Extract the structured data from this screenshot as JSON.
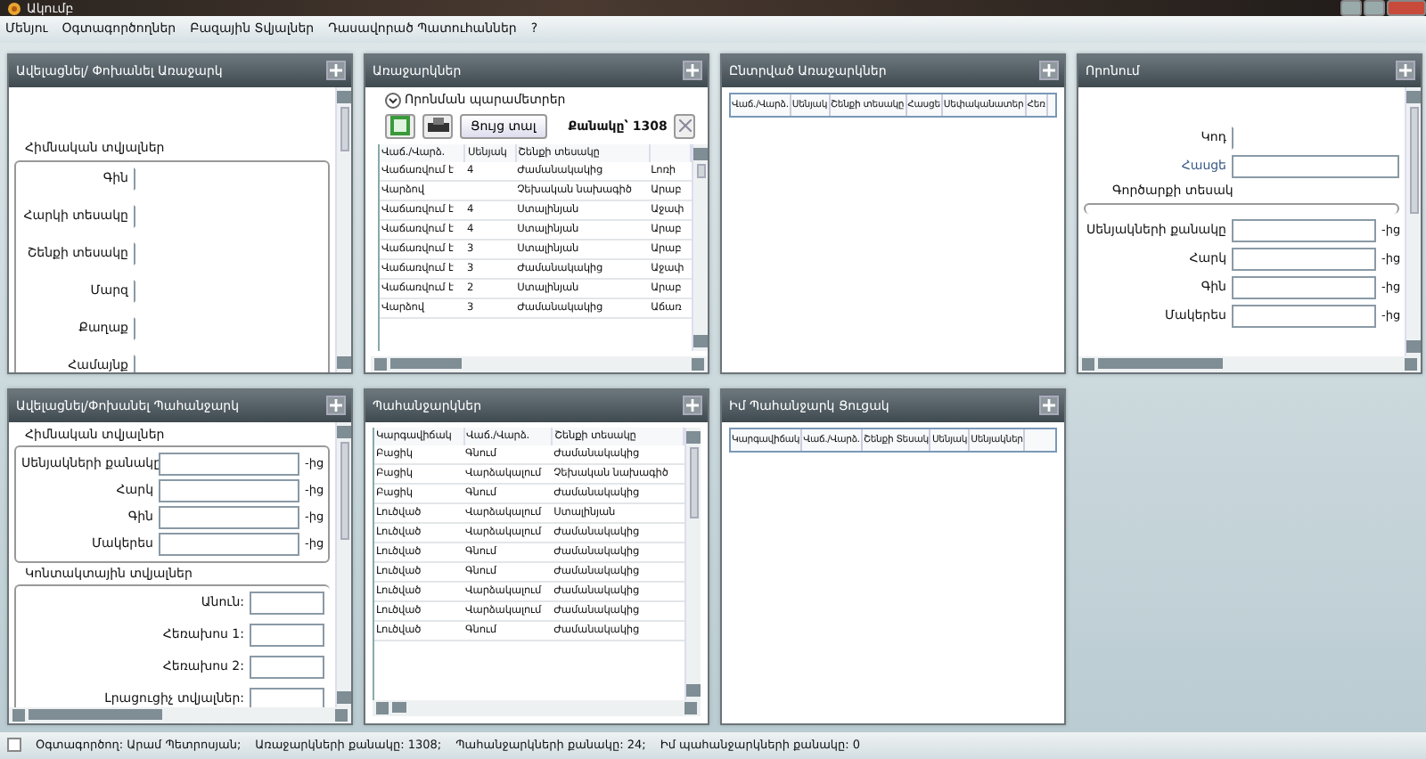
{
  "window": {
    "title": "Ակումբ"
  },
  "menu": [
    "Մենյու",
    "Օգտագործողներ",
    "Բազային Տվյալներ",
    "Դասավորած Պատուհաններ",
    "?"
  ],
  "offer_form": {
    "title": "Ավելացնել/ Փոխանել Առաջարկ",
    "group": {
      "title": "Հիմնական տվյալներ",
      "rows": [
        "Գին",
        "Հարկի տեսակը",
        "Շենքի տեսակը",
        "Մարզ",
        "Քաղաք",
        "Համայնք"
      ]
    }
  },
  "offers": {
    "title": "Առաջարկներ",
    "filter": {
      "label": "Որոնման պարամետրեր",
      "expanded": false
    },
    "show_button": "Ցույց տալ",
    "count": "Քանակը՝ 1308",
    "columns": [
      "Վաճ./Վարձ.",
      "Սենյակ",
      "Շենքի տեսակը",
      ""
    ],
    "rows": [
      [
        "Վաճառվում է",
        "4",
        "Ժամանակակից",
        "Լոռի"
      ],
      [
        "Վարձով",
        "",
        "Չեխական նախագիծ",
        "Արաբ"
      ],
      [
        "Վաճառվում է",
        "4",
        "Ստալինյան",
        "Աջափ"
      ],
      [
        "Վաճառվում է",
        "4",
        "Ստալինյան",
        "Արաբ"
      ],
      [
        "Վաճառվում է",
        "3",
        "Ստալինյան",
        "Արաբ"
      ],
      [
        "Վաճառվում է",
        "3",
        "Ժամանակակից",
        "Աջափ"
      ],
      [
        "Վաճառվում է",
        "2",
        "Ստալինյան",
        "Արաբ"
      ],
      [
        "Վարձով",
        "3",
        "Ժամանակակից",
        "Աճառ"
      ]
    ]
  },
  "selected_offers": {
    "title": "Ընտրված Առաջարկներ",
    "columns": [
      "Վաճ./Վարձ.",
      "Սենյակ",
      "Շենքի տեսակը",
      "Հասցե",
      "Սեփականատեր",
      "Հեռ"
    ]
  },
  "search_form": {
    "title": "Որոնում",
    "fields": [
      "Կոդ",
      "Հասցե"
    ],
    "group": "Գործարքի տեսակ",
    "rows": [
      {
        "label": "Սենյակների քանակը",
        "unit": "-ից"
      },
      {
        "label": "Հարկ",
        "unit": "-ից"
      },
      {
        "label": "Գին",
        "unit": "-ից"
      },
      {
        "label": "Մակերես",
        "unit": "-ից"
      }
    ]
  },
  "demand_form": {
    "title": "Ավելացնել/Փոխանել Պահանջարկ",
    "main": {
      "title": "Հիմնական տվյալներ",
      "rows": [
        {
          "label": "Սենյակների քանակը",
          "unit": "-ից"
        },
        {
          "label": "Հարկ",
          "unit": "-ից"
        },
        {
          "label": "Գին",
          "unit": "-ից"
        },
        {
          "label": "Մակերես",
          "unit": "-ից"
        }
      ]
    },
    "contact": {
      "title": "Կոնտակտային տվյալներ",
      "rows": [
        "Անուն:",
        "Հեռախոս 1:",
        "Հեռախոս 2:",
        "Լրացուցիչ տվյալներ:"
      ]
    }
  },
  "demands": {
    "title": "Պահանջարկներ",
    "columns": [
      "Կարգավիճակ",
      "Վաճ./Վարձ.",
      "Շենքի տեսակը"
    ],
    "rows": [
      [
        "Բացիկ",
        "Գնում",
        "Ժամանակակից"
      ],
      [
        "Բացիկ",
        "Վարձակալում",
        "Չեխական նախագիծ"
      ],
      [
        "Բացիկ",
        "Գնում",
        "Ժամանակակից"
      ],
      [
        "Լուծված",
        "Վարձակալում",
        "Ստալինյան"
      ],
      [
        "Լուծված",
        "Վարձակալում",
        "Ժամանակակից"
      ],
      [
        "Լուծված",
        "Գնում",
        "Ժամանակակից"
      ],
      [
        "Լուծված",
        "Գնում",
        "Ժամանակակից"
      ],
      [
        "Լուծված",
        "Վարձակալում",
        "Ժամանակակից"
      ],
      [
        "Լուծված",
        "Վարձակալում",
        "Ժամանակակից"
      ],
      [
        "Լուծված",
        "Գնում",
        "Ժամանակակից"
      ]
    ]
  },
  "my_demands": {
    "title": "Իմ Պահանջարկ Ցուցակ",
    "columns": [
      "Կարգավիճակ",
      "Վաճ./Վարձ.",
      "Շենքի Տեսակ",
      "Սենյակ",
      "Սենյակներ"
    ]
  },
  "status_bar": {
    "checkbox": {
      "checked": false
    },
    "items": [
      "Օգտագործող: Արամ Պետրոսյան;",
      "Առաջարկների քանակը: 1308;",
      "Պահանջարկների քանակը: 24;",
      "Իմ պահանջարկների քանակը: 0"
    ]
  }
}
